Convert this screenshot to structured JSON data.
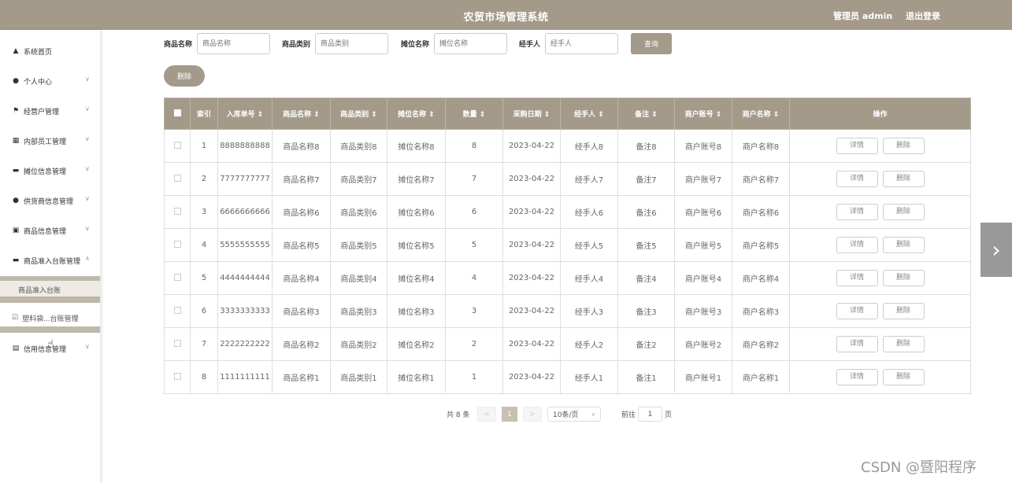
{
  "header": {
    "title": "农贸市场管理系统",
    "user": "管理员 admin",
    "logout": "退出登录"
  },
  "sidebar": {
    "items": [
      {
        "label": "系统首页",
        "icon": "home-icon",
        "glyph": "▲",
        "chev": ""
      },
      {
        "label": "个人中心",
        "icon": "user-icon",
        "glyph": "●",
        "chev": "∨"
      },
      {
        "label": "经营户管理",
        "icon": "flag-icon",
        "glyph": "⚑",
        "chev": "∨"
      },
      {
        "label": "内部员工管理",
        "icon": "grid-icon",
        "glyph": "▦",
        "chev": "∨"
      },
      {
        "label": "摊位信息管理",
        "icon": "briefcase-icon",
        "glyph": "▬",
        "chev": "∨"
      },
      {
        "label": "供货商信息管理",
        "icon": "bulb-icon",
        "glyph": "●",
        "chev": "∨"
      },
      {
        "label": "商品信息管理",
        "icon": "clipboard-check-icon",
        "glyph": "▣",
        "chev": "∨"
      },
      {
        "label": "商品准入台账管理",
        "icon": "book-icon",
        "glyph": "▬",
        "chev": "∧"
      }
    ],
    "sub_items": [
      {
        "label": "商品准入台账"
      },
      {
        "label": "塑料袋...台账管理"
      }
    ],
    "last": {
      "label": "信用信息管理",
      "icon": "document-icon",
      "glyph": "▤",
      "chev": "∨"
    }
  },
  "search": {
    "fields": [
      {
        "label": "商品名称",
        "placeholder": "商品名称"
      },
      {
        "label": "商品类别",
        "placeholder": "商品类别"
      },
      {
        "label": "摊位名称",
        "placeholder": "摊位名称"
      },
      {
        "label": "经手人",
        "placeholder": "经手人"
      }
    ],
    "query_label": "查询"
  },
  "delete_label": "删除",
  "table": {
    "headers": [
      "索引",
      "入库单号 ⇕",
      "商品名称 ⇕",
      "商品类别 ⇕",
      "摊位名称 ⇕",
      "数量 ⇕",
      "采购日期 ⇕",
      "经手人 ⇕",
      "备注 ⇕",
      "商户账号 ⇕",
      "商户名称 ⇕",
      "操作"
    ],
    "rows": [
      [
        "1",
        "8888888888",
        "商品名称8",
        "商品类别8",
        "摊位名称8",
        "8",
        "2023-04-22",
        "经手人8",
        "备注8",
        "商户账号8",
        "商户名称8"
      ],
      [
        "2",
        "7777777777",
        "商品名称7",
        "商品类别7",
        "摊位名称7",
        "7",
        "2023-04-22",
        "经手人7",
        "备注7",
        "商户账号7",
        "商户名称7"
      ],
      [
        "3",
        "6666666666",
        "商品名称6",
        "商品类别6",
        "摊位名称6",
        "6",
        "2023-04-22",
        "经手人6",
        "备注6",
        "商户账号6",
        "商户名称6"
      ],
      [
        "4",
        "5555555555",
        "商品名称5",
        "商品类别5",
        "摊位名称5",
        "5",
        "2023-04-22",
        "经手人5",
        "备注5",
        "商户账号5",
        "商户名称5"
      ],
      [
        "5",
        "4444444444",
        "商品名称4",
        "商品类别4",
        "摊位名称4",
        "4",
        "2023-04-22",
        "经手人4",
        "备注4",
        "商户账号4",
        "商户名称4"
      ],
      [
        "6",
        "3333333333",
        "商品名称3",
        "商品类别3",
        "摊位名称3",
        "3",
        "2023-04-22",
        "经手人3",
        "备注3",
        "商户账号3",
        "商户名称3"
      ],
      [
        "7",
        "2222222222",
        "商品名称2",
        "商品类别2",
        "摊位名称2",
        "2",
        "2023-04-22",
        "经手人2",
        "备注2",
        "商户账号2",
        "商户名称2"
      ],
      [
        "8",
        "1111111111",
        "商品名称1",
        "商品类别1",
        "摊位名称1",
        "1",
        "2023-04-22",
        "经手人1",
        "备注1",
        "商户账号1",
        "商户名称1"
      ]
    ],
    "detail_label": "详情",
    "row_delete_label": "删除"
  },
  "pagination": {
    "total": "共 8 条",
    "prev": "<",
    "current": "1",
    "next": ">",
    "page_size": "10条/页",
    "goto_prefix": "前往",
    "goto_value": "1",
    "goto_suffix": "页"
  },
  "watermark": "CSDN @暨阳程序",
  "colors": {
    "accent": "#a49a8a"
  }
}
